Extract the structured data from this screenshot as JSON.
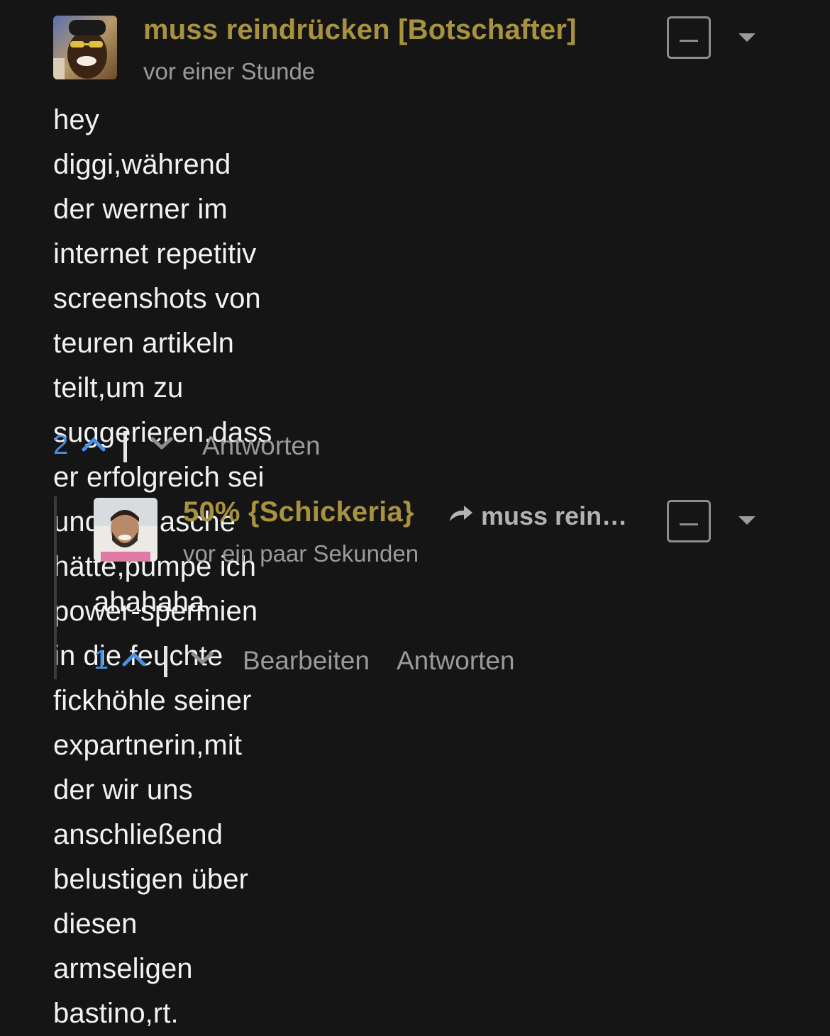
{
  "comments": [
    {
      "author": "muss reindrücken [Botschafter]",
      "time": "vor einer Stunde",
      "lines": [
        "hey diggi,während der werner im internet repetitiv",
        "screenshots von teuren artikeln teilt,um zu",
        "suggerieren,dass er erfolgreich sei und viel asche",
        "hätte,pumpe ich power-spermien in die feuchte",
        "fickhöhle seiner expartnerin,mit der wir uns",
        "anschließend belustigen über diesen armseligen",
        "bastino,rt."
      ],
      "votes": "2",
      "reply_label": "Antworten"
    },
    {
      "author": "50% {Schickeria}",
      "reply_to": "muss rein…",
      "time": "vor ein paar Sekunden",
      "lines": [
        "ahahaha"
      ],
      "votes": "1",
      "edit_label": "Bearbeiten",
      "reply_label": "Antworten"
    }
  ],
  "icons": {
    "upvote": "chevron-up-icon",
    "downvote": "chevron-down-icon",
    "collapse": "collapse-icon",
    "menu": "caret-down-icon",
    "reply_arrow": "share-arrow-icon"
  },
  "colors": {
    "background": "#151516",
    "author": "#a8923f",
    "vote": "#4a90e2",
    "muted": "#9a9a9a",
    "text": "#f2f2f2"
  }
}
